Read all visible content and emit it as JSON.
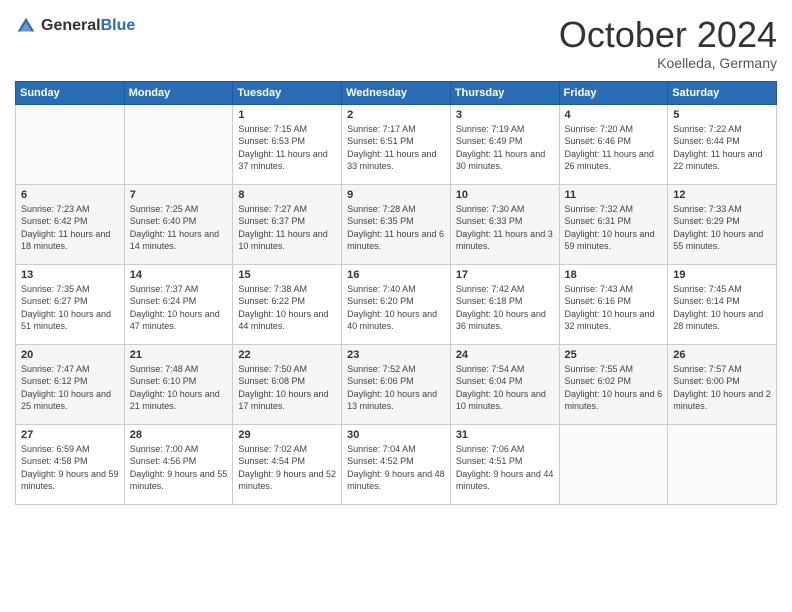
{
  "header": {
    "logo_general": "General",
    "logo_blue": "Blue",
    "month": "October 2024",
    "location": "Koelleda, Germany"
  },
  "days_of_week": [
    "Sunday",
    "Monday",
    "Tuesday",
    "Wednesday",
    "Thursday",
    "Friday",
    "Saturday"
  ],
  "weeks": [
    [
      {
        "day": "",
        "sunrise": "",
        "sunset": "",
        "daylight": ""
      },
      {
        "day": "",
        "sunrise": "",
        "sunset": "",
        "daylight": ""
      },
      {
        "day": "1",
        "sunrise": "Sunrise: 7:15 AM",
        "sunset": "Sunset: 6:53 PM",
        "daylight": "Daylight: 11 hours and 37 minutes."
      },
      {
        "day": "2",
        "sunrise": "Sunrise: 7:17 AM",
        "sunset": "Sunset: 6:51 PM",
        "daylight": "Daylight: 11 hours and 33 minutes."
      },
      {
        "day": "3",
        "sunrise": "Sunrise: 7:19 AM",
        "sunset": "Sunset: 6:49 PM",
        "daylight": "Daylight: 11 hours and 30 minutes."
      },
      {
        "day": "4",
        "sunrise": "Sunrise: 7:20 AM",
        "sunset": "Sunset: 6:46 PM",
        "daylight": "Daylight: 11 hours and 26 minutes."
      },
      {
        "day": "5",
        "sunrise": "Sunrise: 7:22 AM",
        "sunset": "Sunset: 6:44 PM",
        "daylight": "Daylight: 11 hours and 22 minutes."
      }
    ],
    [
      {
        "day": "6",
        "sunrise": "Sunrise: 7:23 AM",
        "sunset": "Sunset: 6:42 PM",
        "daylight": "Daylight: 11 hours and 18 minutes."
      },
      {
        "day": "7",
        "sunrise": "Sunrise: 7:25 AM",
        "sunset": "Sunset: 6:40 PM",
        "daylight": "Daylight: 11 hours and 14 minutes."
      },
      {
        "day": "8",
        "sunrise": "Sunrise: 7:27 AM",
        "sunset": "Sunset: 6:37 PM",
        "daylight": "Daylight: 11 hours and 10 minutes."
      },
      {
        "day": "9",
        "sunrise": "Sunrise: 7:28 AM",
        "sunset": "Sunset: 6:35 PM",
        "daylight": "Daylight: 11 hours and 6 minutes."
      },
      {
        "day": "10",
        "sunrise": "Sunrise: 7:30 AM",
        "sunset": "Sunset: 6:33 PM",
        "daylight": "Daylight: 11 hours and 3 minutes."
      },
      {
        "day": "11",
        "sunrise": "Sunrise: 7:32 AM",
        "sunset": "Sunset: 6:31 PM",
        "daylight": "Daylight: 10 hours and 59 minutes."
      },
      {
        "day": "12",
        "sunrise": "Sunrise: 7:33 AM",
        "sunset": "Sunset: 6:29 PM",
        "daylight": "Daylight: 10 hours and 55 minutes."
      }
    ],
    [
      {
        "day": "13",
        "sunrise": "Sunrise: 7:35 AM",
        "sunset": "Sunset: 6:27 PM",
        "daylight": "Daylight: 10 hours and 51 minutes."
      },
      {
        "day": "14",
        "sunrise": "Sunrise: 7:37 AM",
        "sunset": "Sunset: 6:24 PM",
        "daylight": "Daylight: 10 hours and 47 minutes."
      },
      {
        "day": "15",
        "sunrise": "Sunrise: 7:38 AM",
        "sunset": "Sunset: 6:22 PM",
        "daylight": "Daylight: 10 hours and 44 minutes."
      },
      {
        "day": "16",
        "sunrise": "Sunrise: 7:40 AM",
        "sunset": "Sunset: 6:20 PM",
        "daylight": "Daylight: 10 hours and 40 minutes."
      },
      {
        "day": "17",
        "sunrise": "Sunrise: 7:42 AM",
        "sunset": "Sunset: 6:18 PM",
        "daylight": "Daylight: 10 hours and 36 minutes."
      },
      {
        "day": "18",
        "sunrise": "Sunrise: 7:43 AM",
        "sunset": "Sunset: 6:16 PM",
        "daylight": "Daylight: 10 hours and 32 minutes."
      },
      {
        "day": "19",
        "sunrise": "Sunrise: 7:45 AM",
        "sunset": "Sunset: 6:14 PM",
        "daylight": "Daylight: 10 hours and 28 minutes."
      }
    ],
    [
      {
        "day": "20",
        "sunrise": "Sunrise: 7:47 AM",
        "sunset": "Sunset: 6:12 PM",
        "daylight": "Daylight: 10 hours and 25 minutes."
      },
      {
        "day": "21",
        "sunrise": "Sunrise: 7:48 AM",
        "sunset": "Sunset: 6:10 PM",
        "daylight": "Daylight: 10 hours and 21 minutes."
      },
      {
        "day": "22",
        "sunrise": "Sunrise: 7:50 AM",
        "sunset": "Sunset: 6:08 PM",
        "daylight": "Daylight: 10 hours and 17 minutes."
      },
      {
        "day": "23",
        "sunrise": "Sunrise: 7:52 AM",
        "sunset": "Sunset: 6:06 PM",
        "daylight": "Daylight: 10 hours and 13 minutes."
      },
      {
        "day": "24",
        "sunrise": "Sunrise: 7:54 AM",
        "sunset": "Sunset: 6:04 PM",
        "daylight": "Daylight: 10 hours and 10 minutes."
      },
      {
        "day": "25",
        "sunrise": "Sunrise: 7:55 AM",
        "sunset": "Sunset: 6:02 PM",
        "daylight": "Daylight: 10 hours and 6 minutes."
      },
      {
        "day": "26",
        "sunrise": "Sunrise: 7:57 AM",
        "sunset": "Sunset: 6:00 PM",
        "daylight": "Daylight: 10 hours and 2 minutes."
      }
    ],
    [
      {
        "day": "27",
        "sunrise": "Sunrise: 6:59 AM",
        "sunset": "Sunset: 4:58 PM",
        "daylight": "Daylight: 9 hours and 59 minutes."
      },
      {
        "day": "28",
        "sunrise": "Sunrise: 7:00 AM",
        "sunset": "Sunset: 4:56 PM",
        "daylight": "Daylight: 9 hours and 55 minutes."
      },
      {
        "day": "29",
        "sunrise": "Sunrise: 7:02 AM",
        "sunset": "Sunset: 4:54 PM",
        "daylight": "Daylight: 9 hours and 52 minutes."
      },
      {
        "day": "30",
        "sunrise": "Sunrise: 7:04 AM",
        "sunset": "Sunset: 4:52 PM",
        "daylight": "Daylight: 9 hours and 48 minutes."
      },
      {
        "day": "31",
        "sunrise": "Sunrise: 7:06 AM",
        "sunset": "Sunset: 4:51 PM",
        "daylight": "Daylight: 9 hours and 44 minutes."
      },
      {
        "day": "",
        "sunrise": "",
        "sunset": "",
        "daylight": ""
      },
      {
        "day": "",
        "sunrise": "",
        "sunset": "",
        "daylight": ""
      }
    ]
  ]
}
